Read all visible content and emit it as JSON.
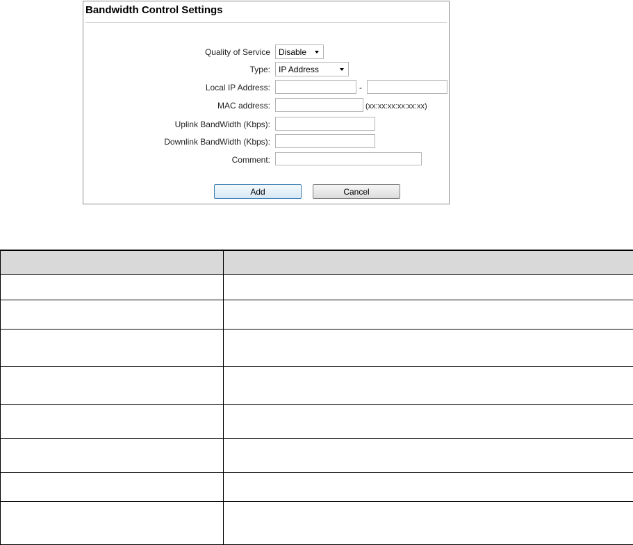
{
  "panel": {
    "title": "Bandwidth Control Settings",
    "qos": {
      "label": "Quality of Service",
      "value": "Disable"
    },
    "type": {
      "label": "Type:",
      "value": "IP Address"
    },
    "local_ip": {
      "label": "Local IP Address:",
      "start": "",
      "end": "",
      "separator": "-"
    },
    "mac": {
      "label": "MAC address:",
      "value": "",
      "hint": "(xx:xx:xx:xx:xx:xx)"
    },
    "uplink": {
      "label": "Uplink BandWidth (Kbps):",
      "value": ""
    },
    "downlink": {
      "label": "Downlink BandWidth (Kbps):",
      "value": ""
    },
    "comment": {
      "label": "Comment:",
      "value": ""
    },
    "buttons": {
      "add": "Add",
      "cancel": "Cancel"
    }
  },
  "table": {
    "header": [
      "",
      ""
    ],
    "rows": [
      [
        "",
        ""
      ],
      [
        "",
        ""
      ],
      [
        "",
        ""
      ],
      [
        "",
        ""
      ],
      [
        "",
        ""
      ],
      [
        "",
        ""
      ],
      [
        "",
        ""
      ],
      [
        "",
        ""
      ]
    ]
  }
}
